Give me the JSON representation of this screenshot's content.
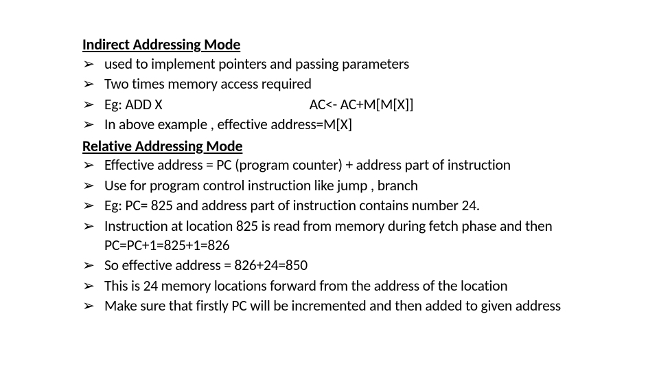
{
  "bullet_glyph": "➢",
  "sections": [
    {
      "heading": "Indirect Addressing Mode",
      "items": [
        "used to implement pointers and passing parameters",
        "Two times memory access required",
        "Eg: ADD X                                              AC<- AC+M[M[X]]",
        "In above example , effective address=M[X]"
      ]
    },
    {
      "heading": "Relative Addressing Mode",
      "items": [
        "Effective address = PC (program counter) + address part of instruction",
        "Use for program control instruction like jump , branch",
        "Eg:  PC= 825  and address part of instruction contains number 24.",
        "Instruction at location 825 is read from memory during fetch phase and then PC=PC+1=825+1=826",
        "So effective address = 826+24=850",
        "This is 24 memory locations forward from the address of the location",
        "Make sure that firstly PC will be incremented and then added to given address"
      ]
    }
  ]
}
